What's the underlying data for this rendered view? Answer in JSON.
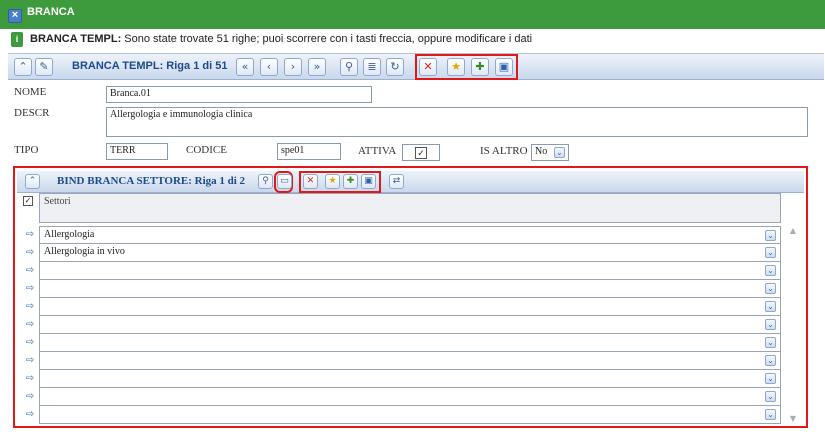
{
  "window": {
    "title": "BRANCA"
  },
  "message": {
    "bold": "BRANCA TEMPL:",
    "text": " Sono state trovate 51 righe; puoi scorrere con i tasti freccia, oppure modificare i dati"
  },
  "toolbar": {
    "title": "BRANCA TEMPL: Riga 1 di 51"
  },
  "form": {
    "nome_label": "NOME",
    "nome_value": "Branca.01",
    "descr_label": "DESCR",
    "descr_value": "Allergologia e immunologia clinica",
    "tipo_label": "TIPO",
    "tipo_value": "TERR",
    "codice_label": "CODICE",
    "codice_value": "spe01",
    "attiva_label": "ATTIVA",
    "attiva_checked": true,
    "isaltro_label": "IS ALTRO",
    "isaltro_value": "No"
  },
  "sub": {
    "title": "BIND BRANCA SETTORE: Riga 1 di 2",
    "column_header": "Settori",
    "rows": [
      "Allergologia",
      "Allergologia in vivo",
      "",
      "",
      "",
      "",
      "",
      "",
      "",
      "",
      "",
      ""
    ]
  }
}
